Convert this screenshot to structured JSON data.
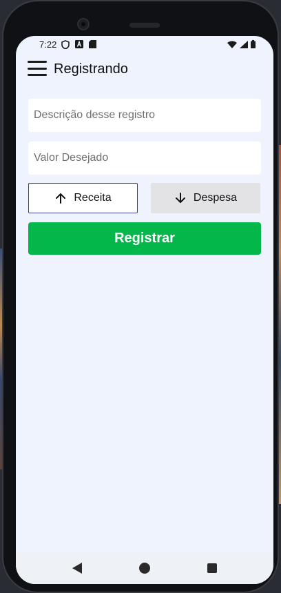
{
  "status_bar": {
    "time": "7:22",
    "left_icons": [
      "shield-icon",
      "a-badge-icon",
      "sd-card-icon"
    ],
    "right_icons": [
      "wifi-icon",
      "cell-signal-icon",
      "battery-icon"
    ]
  },
  "app_bar": {
    "title": "Registrando",
    "menu_icon": "hamburger-menu-icon"
  },
  "form": {
    "description_placeholder": "Descrição desse registro",
    "value_placeholder": "Valor Desejado",
    "receita_label": "Receita",
    "despesa_label": "Despesa",
    "selected_type": "Receita",
    "register_label": "Registrar"
  },
  "nav_bar": {
    "buttons": [
      "back",
      "home",
      "recents"
    ]
  },
  "colors": {
    "background": "#eef3fd",
    "accent_green": "#04b74a",
    "selected_border": "#3d3fa0",
    "unselected_fill": "#e3e3e6"
  }
}
